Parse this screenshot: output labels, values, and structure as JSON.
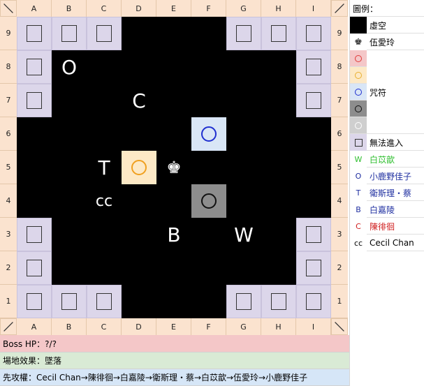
{
  "board": {
    "columns": [
      "A",
      "B",
      "C",
      "D",
      "E",
      "F",
      "G",
      "H",
      "I"
    ],
    "rows": [
      "9",
      "8",
      "7",
      "6",
      "5",
      "4",
      "3",
      "2",
      "1"
    ],
    "blocked_cells": [
      "A9",
      "B9",
      "C9",
      "G9",
      "H9",
      "I9",
      "A8",
      "I8",
      "A7",
      "I7",
      "A3",
      "I3",
      "A2",
      "I2",
      "A1",
      "B1",
      "C1",
      "G1",
      "H1",
      "I1"
    ],
    "spell_cells": [
      {
        "cell": "F6",
        "color": "blue"
      },
      {
        "cell": "D5",
        "color": "yellow"
      },
      {
        "cell": "F4",
        "color": "gray"
      }
    ],
    "boss_cell": "E5",
    "boss_icon": "king-chess-icon",
    "letters": [
      {
        "label": "O",
        "cell": "B8"
      },
      {
        "label": "C",
        "cell": "D7"
      },
      {
        "label": "T",
        "cell": "C5"
      },
      {
        "label": "cc",
        "cell": "C4"
      },
      {
        "label": "B",
        "cell": "E3"
      },
      {
        "label": "W",
        "cell": "G3"
      }
    ]
  },
  "legend": {
    "title": "圖例：",
    "void_label": "虛空",
    "boss_label": "伍愛玲",
    "spell_label": "咒符",
    "spell_colors": [
      "#e03a3a",
      "#e8b030",
      "#1f2fd0",
      "#111111",
      "#ffffff"
    ],
    "no_entry_label": "無法進入",
    "players": [
      {
        "symbol": "W",
        "name": "白苡歆",
        "color": "#2fbf2f"
      },
      {
        "symbol": "O",
        "name": "小鹿野佳子",
        "color": "#1f2fa0"
      },
      {
        "symbol": "T",
        "name": "衛斯理・蔡",
        "color": "#1f2fa0"
      },
      {
        "symbol": "B",
        "name": "白嘉陵",
        "color": "#1f2fa0"
      },
      {
        "symbol": "C",
        "name": "陳徘徊",
        "color": "#d02020"
      },
      {
        "symbol": "cc",
        "name": "Cecil Chan",
        "color": "#000000"
      }
    ]
  },
  "footer": {
    "boss_hp": "Boss HP：?/?",
    "field_effect": "場地效果：墜落",
    "turn_order": "先攻權：Cecil Chan→陳徘徊→白嘉陵→衛斯理・蔡→白苡歆→伍愛玲→小鹿野佳子"
  }
}
